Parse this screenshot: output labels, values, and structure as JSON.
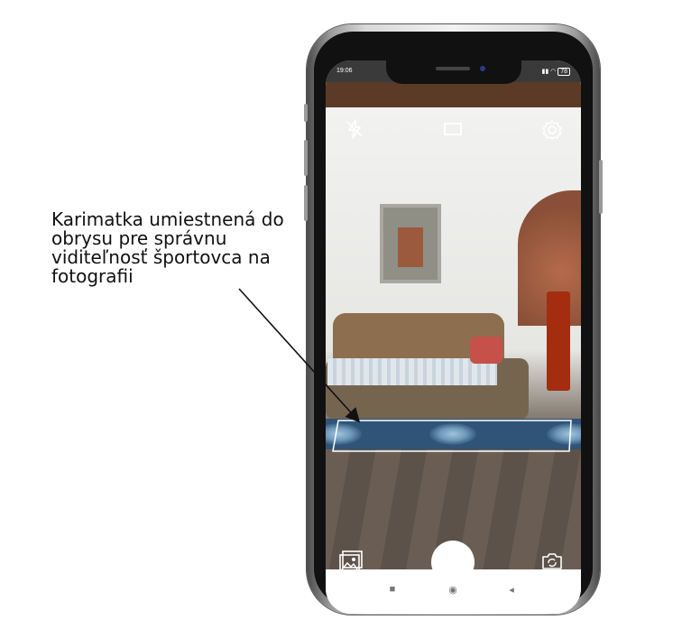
{
  "annotation": {
    "lines": [
      "Karimatka umiestnená do",
      "obrysu pre správnu",
      "viditeľnosť športovca na",
      "fotografii"
    ]
  },
  "statusbar": {
    "time": "19:06",
    "battery": "78"
  },
  "camera_top_icons": [
    "flash-off-icon",
    "aspect-ratio-icon",
    "settings-gear-icon"
  ],
  "camera_bottom_icons": [
    "gallery-icon",
    "shutter-button",
    "switch-camera-icon"
  ],
  "android_nav": {
    "recent": "■",
    "home": "◉",
    "back": "◂"
  },
  "colors": {
    "guide_outline": "#ffffff",
    "mat": "#2f5477"
  }
}
